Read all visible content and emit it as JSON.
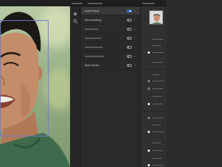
{
  "colors": {
    "accent": "#3b73d8",
    "face_box": "#6f7bd0",
    "panel_bg": "#2a2a2a",
    "active_row": "#3a3a3a"
  },
  "toolbar": {
    "tools": [
      {
        "icon": "hand-icon"
      },
      {
        "icon": "zoom-icon"
      }
    ]
  },
  "filters": [
    {
      "label": "Smart Portrait",
      "toggle": true,
      "active": true
    },
    {
      "label": "Skin Smoothing",
      "toggle": false,
      "active": false
    },
    {
      "label": "",
      "toggle": false,
      "active": false
    },
    {
      "label": "",
      "toggle": false,
      "active": false
    },
    {
      "label": "",
      "toggle": false,
      "active": false
    },
    {
      "label": "",
      "toggle": false,
      "active": false
    },
    {
      "label": "Style Transfer",
      "toggle": false,
      "active": false
    }
  ],
  "properties": {
    "preview_icon": "portrait-thumbnail",
    "checkboxes": [
      true,
      true,
      false,
      true,
      true,
      true,
      true
    ]
  }
}
